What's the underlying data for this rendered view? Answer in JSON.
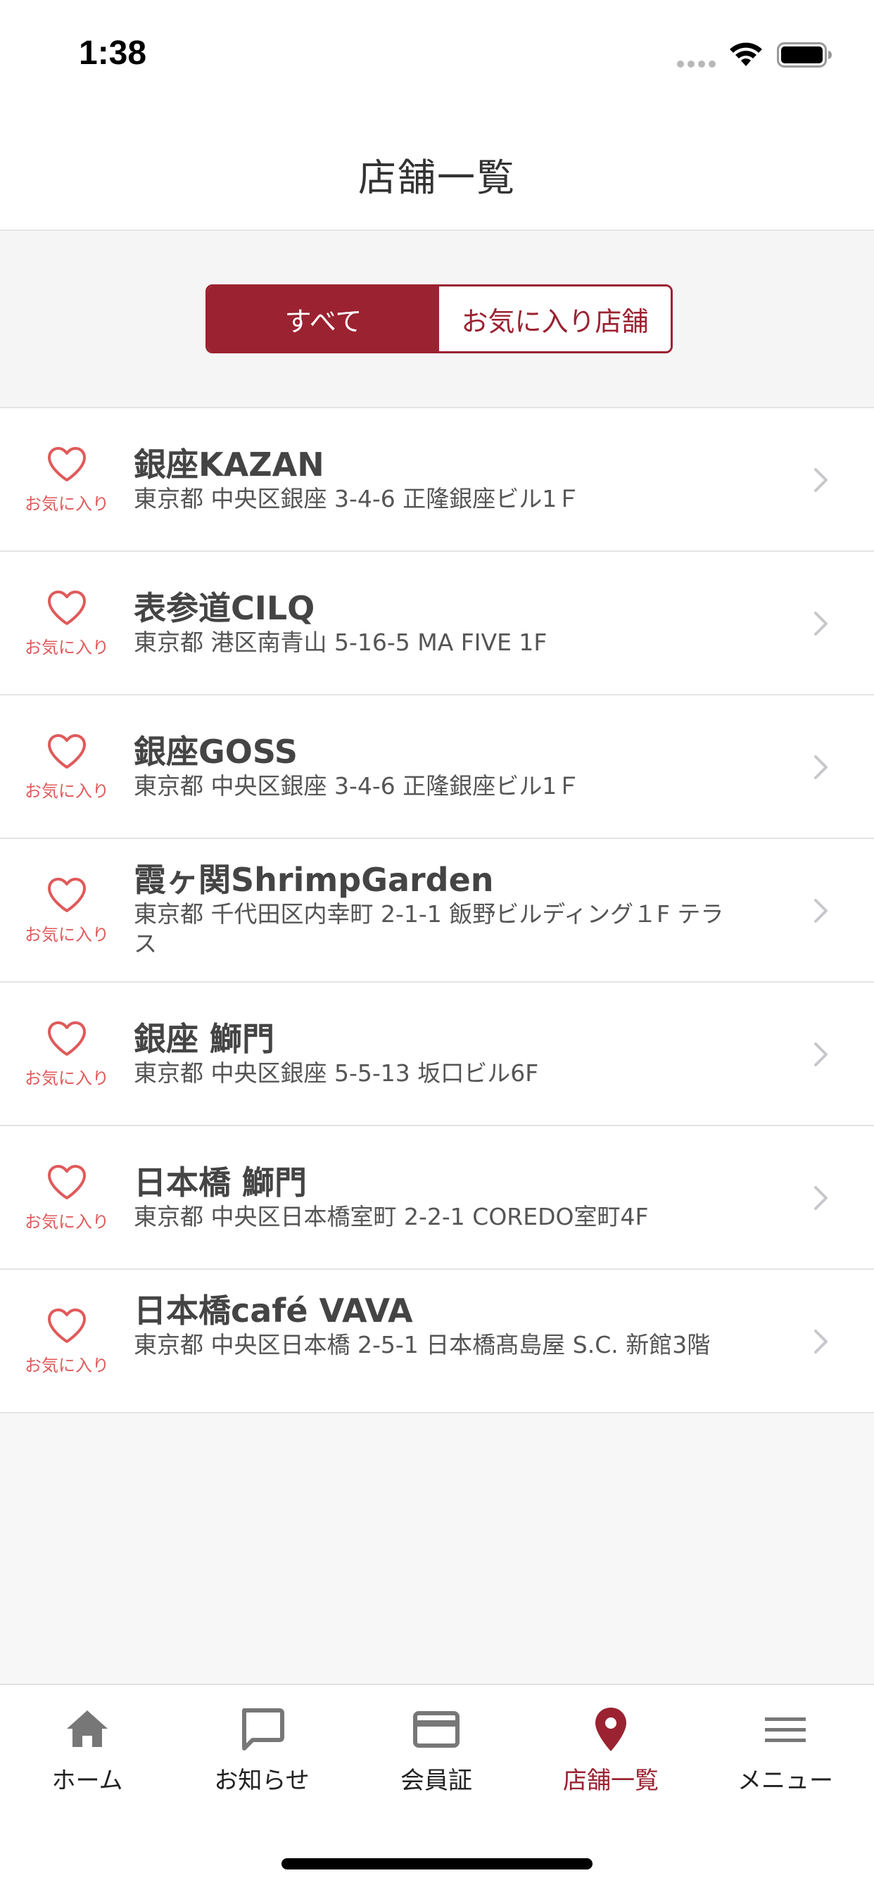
{
  "status_bar": {
    "time": "1:38"
  },
  "header": {
    "title": "店舗一覧"
  },
  "segment": {
    "all_label": "すべて",
    "favorites_label": "お気に入り店舗",
    "selected": "すべて"
  },
  "stores": [
    {
      "name": "銀座KAZAN",
      "address": "東京都 中央区銀座 3-4-6 正隆銀座ビル1Ｆ",
      "favorite_label": "お気に入り"
    },
    {
      "name": "表参道CILQ",
      "address": "東京都 港区南青山 5-16-5 MA FIVE 1F",
      "favorite_label": "お気に入り"
    },
    {
      "name": "銀座GOSS",
      "address": "東京都 中央区銀座 3-4-6 正隆銀座ビル1Ｆ",
      "favorite_label": "お気に入り"
    },
    {
      "name": "霞ヶ関ShrimpGarden",
      "address": "東京都 千代田区内幸町 2-1-1 飯野ビルディング１F テラス",
      "favorite_label": "お気に入り"
    },
    {
      "name": "銀座 鰤門",
      "address": "東京都 中央区銀座 5-5-13 坂口ビル6F",
      "favorite_label": "お気に入り"
    },
    {
      "name": "日本橋 鰤門",
      "address": "東京都 中央区日本橋室町 2-2-1 COREDO室町4F",
      "favorite_label": "お気に入り"
    },
    {
      "name": "日本橋café VAVA",
      "address": "東京都 中央区日本橋 2-5-1 日本橋髙島屋 S.C. 新館3階",
      "favorite_label": "お気に入り"
    }
  ],
  "tab_bar": {
    "items": [
      {
        "label": "ホーム",
        "icon": "home-icon",
        "active": false
      },
      {
        "label": "お知らせ",
        "icon": "chat-bubble-icon",
        "active": false
      },
      {
        "label": "会員証",
        "icon": "credit-card-icon",
        "active": false
      },
      {
        "label": "店舗一覧",
        "icon": "map-pin-icon",
        "active": true
      },
      {
        "label": "メニュー",
        "icon": "hamburger-menu-icon",
        "active": false
      }
    ]
  },
  "colors": {
    "accent": "#9b2231",
    "favorite": "#e05a5a",
    "text_primary": "#444444",
    "text_secondary": "#555555",
    "background": "#f7f7f7"
  }
}
